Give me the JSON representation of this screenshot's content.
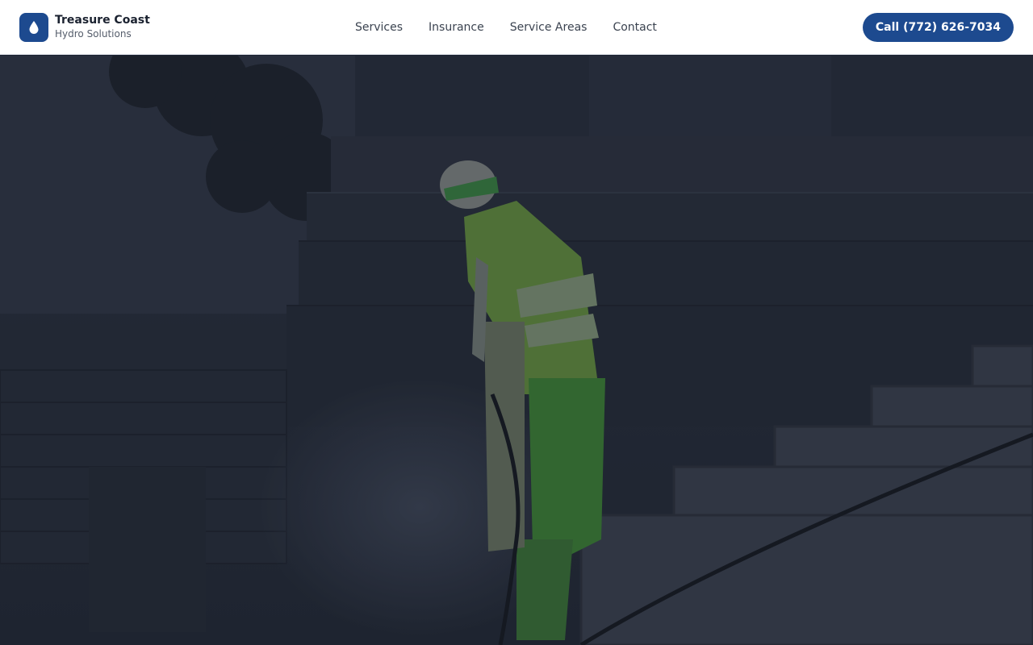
{
  "header": {
    "brand_name": "Treasure Coast",
    "brand_sub": "Hydro Solutions",
    "logo_icon": "water-drop-icon",
    "nav": [
      {
        "label": "Services"
      },
      {
        "label": "Insurance"
      },
      {
        "label": "Service Areas"
      },
      {
        "label": "Contact"
      }
    ],
    "cta_label": "Call (772) 626-7034"
  },
  "hero": {
    "image_subject": "pressure-washing-photo"
  },
  "colors": {
    "brand": "#1d4a8f",
    "header_bg": "#ffffff",
    "nav_text": "#3b4350",
    "hero_overlay": "#1c2333"
  }
}
